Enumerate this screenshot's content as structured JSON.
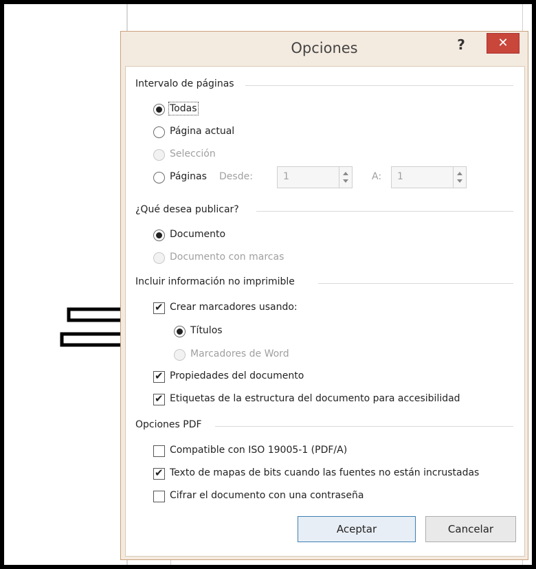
{
  "dialog": {
    "title": "Opciones",
    "help_label": "?",
    "close_label": "✕"
  },
  "page_range": {
    "heading": "Intervalo de páginas",
    "all": "Todas",
    "current": "Página actual",
    "selection": "Selección",
    "pages": "Páginas",
    "from_label": "Desde:",
    "from_value": "1",
    "to_label": "A:",
    "to_value": "1",
    "selected": "Todas"
  },
  "publish": {
    "heading": "¿Qué desea publicar?",
    "document": "Documento",
    "document_markup": "Documento con marcas",
    "selected": "Documento"
  },
  "nonprint": {
    "heading": "Incluir información no imprimible",
    "create_bookmarks": "Crear marcadores usando:",
    "create_bookmarks_checked": true,
    "headings": "Títulos",
    "word_bookmarks": "Marcadores de Word",
    "bookmarks_source": "Títulos",
    "doc_properties": "Propiedades del documento",
    "doc_properties_checked": true,
    "structure_tags": "Etiquetas de la estructura del documento para accesibilidad",
    "structure_tags_checked": true
  },
  "pdf": {
    "heading": "Opciones PDF",
    "iso": "Compatible con ISO 19005-1 (PDF/A)",
    "iso_checked": false,
    "bitmap": "Texto de mapas de bits cuando las fuentes no están incrustadas",
    "bitmap_checked": true,
    "encrypt": "Cifrar el documento con una contraseña",
    "encrypt_checked": false
  },
  "buttons": {
    "ok": "Aceptar",
    "cancel": "Cancelar"
  },
  "colors": {
    "dialog_bg": "#f4ebe0",
    "close_bg": "#c8463a",
    "frame": "#000000"
  }
}
